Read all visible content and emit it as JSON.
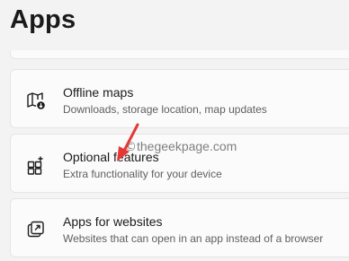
{
  "page": {
    "title": "Apps"
  },
  "cards": [
    {
      "title": "Offline maps",
      "subtitle": "Downloads, storage location, map updates",
      "icon": "offline-map-icon"
    },
    {
      "title": "Optional features",
      "subtitle": "Extra functionality for your device",
      "icon": "optional-features-icon"
    },
    {
      "title": "Apps for websites",
      "subtitle": "Websites that can open in an app instead of a browser",
      "icon": "open-in-app-icon"
    }
  ],
  "watermark": {
    "symbol": "©",
    "text": "thegeekpage.com"
  },
  "colors": {
    "background": "#f3f3f3",
    "card": "#fbfbfb",
    "annotation_arrow": "#e53935"
  }
}
